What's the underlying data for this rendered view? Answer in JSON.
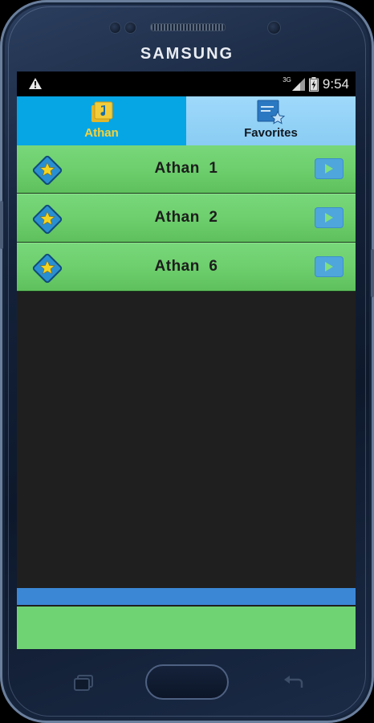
{
  "device": {
    "brand": "SAMSUNG"
  },
  "status_bar": {
    "time": "9:54",
    "network": "3G",
    "icons": [
      "warning-icon",
      "signal-icon",
      "battery-icon"
    ]
  },
  "tabs": [
    {
      "label": "Athan",
      "icon": "music-folder-icon",
      "active": true
    },
    {
      "label": "Favorites",
      "icon": "favorite-list-icon",
      "active": false
    }
  ],
  "athan_list": [
    {
      "title": "Athan  1",
      "icon": "star-diamond-icon",
      "action_icon": "play-icon"
    },
    {
      "title": "Athan  2",
      "icon": "star-diamond-icon",
      "action_icon": "play-icon"
    },
    {
      "title": "Athan  6",
      "icon": "star-diamond-icon",
      "action_icon": "play-icon"
    }
  ],
  "colors": {
    "active_tab": "#06a6e5",
    "inactive_tab": "#9fd9fb",
    "active_tab_label": "#f7d23a",
    "row_green": "#6fd06f",
    "play_button": "#4fa6dc",
    "blue_bar": "#3b87d6",
    "screen_background": "#1f1f1f"
  }
}
